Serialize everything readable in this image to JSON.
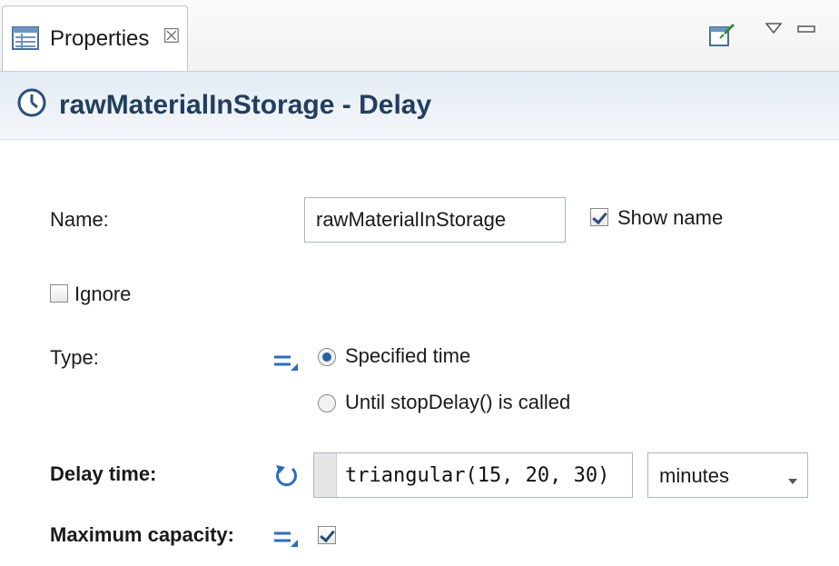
{
  "tab": {
    "label": "Properties",
    "close_glyph": "☒"
  },
  "toolbar": {
    "pin_icon": "pin-icon",
    "view_menu_icon": "view-menu-icon",
    "minimize_icon": "minimize-icon"
  },
  "header": {
    "title": "rawMaterialInStorage - Delay",
    "icon": "clock-icon"
  },
  "form": {
    "name_label": "Name:",
    "name_value": "rawMaterialInStorage",
    "show_name_label": "Show name",
    "show_name_checked": true,
    "ignore_label": "Ignore",
    "ignore_checked": false,
    "type_label": "Type:",
    "type_options": [
      {
        "label": "Specified time",
        "selected": true
      },
      {
        "label": "Until stopDelay() is called",
        "selected": false
      }
    ],
    "delay_time_label": "Delay time:",
    "delay_time_value": "triangular(15, 20, 30)",
    "delay_time_unit": "minutes",
    "max_capacity_label": "Maximum capacity:",
    "max_capacity_checked": true
  },
  "colors": {
    "title": "#213e5e",
    "accent": "#2a5fa0",
    "header_bg": "#e4ebf4"
  }
}
